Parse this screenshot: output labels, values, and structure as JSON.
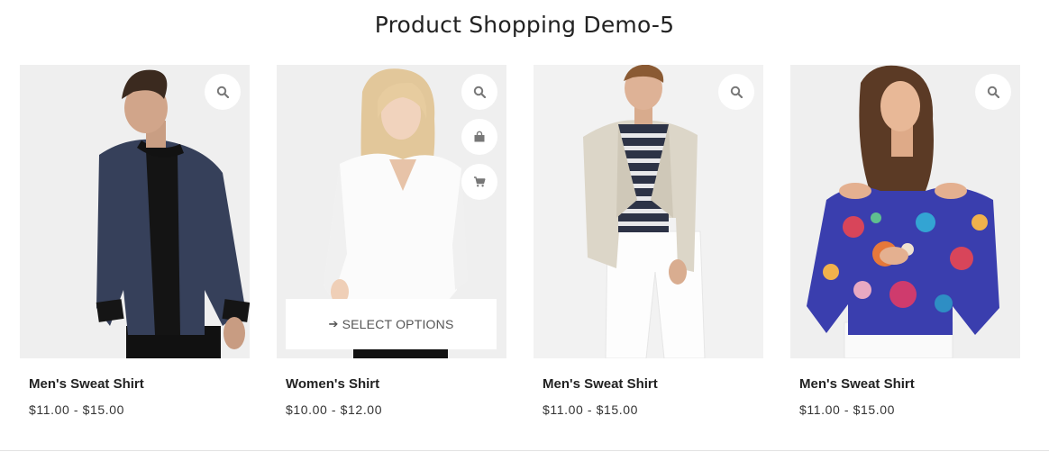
{
  "page": {
    "title": "Product Shopping Demo-5"
  },
  "products": [
    {
      "name": "Men's Sweat Shirt",
      "price": "$11.00 - $15.00",
      "image": "man-in-navy-bomber-jacket",
      "icons": [
        "search-icon"
      ]
    },
    {
      "name": "Women's Shirt",
      "price": "$10.00 - $12.00",
      "image": "woman-in-white-blouse",
      "icons": [
        "search-icon",
        "shopping-bag-icon",
        "cart-icon"
      ],
      "hover_button": "SELECT OPTIONS",
      "hover_button_icon": "arrow-right-icon"
    },
    {
      "name": "Men's Sweat Shirt",
      "price": "$11.00 - $15.00",
      "image": "man-in-beige-blazer",
      "icons": [
        "search-icon"
      ]
    },
    {
      "name": "Men's Sweat Shirt",
      "price": "$11.00 - $15.00",
      "image": "woman-in-floral-off-shoulder-top",
      "icons": [
        "search-icon"
      ]
    }
  ],
  "colors": {
    "image_bg": "#eeeeee",
    "icon_gray": "#777777",
    "text_dark": "#222222",
    "divider": "#e2e2e2"
  }
}
